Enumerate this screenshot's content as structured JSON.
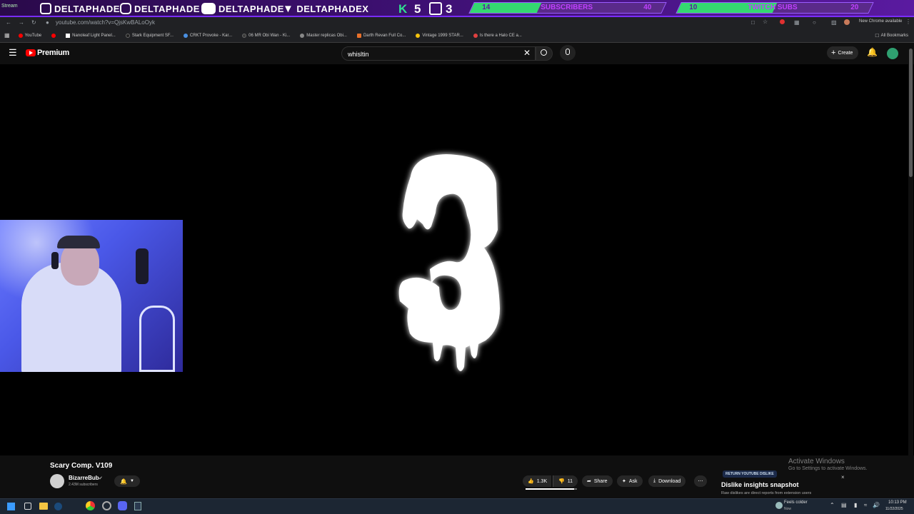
{
  "overlay": {
    "socials": [
      {
        "icon": "twitch-icon",
        "handle": "DELTAPHADE"
      },
      {
        "icon": "instagram-icon",
        "handle": "DELTAPHADE"
      },
      {
        "icon": "youtube-icon",
        "handle": "DELTAPHADE"
      },
      {
        "icon": "twitter-icon",
        "handle": "DELTAPHADEX"
      }
    ],
    "k_count": "5",
    "sub_count": "3",
    "goals": [
      {
        "current": "14",
        "label": "SUBSCRIBERS",
        "target": "40",
        "progress": 0.35
      },
      {
        "current": "10",
        "label": "TWITCH SUBS",
        "target": "20",
        "progress": 0.5
      }
    ]
  },
  "browser": {
    "tab_label": "Stream",
    "url": "youtube.com/watch?v=QjsKwBALoOyk",
    "chrome_notice": "New Chrome available",
    "all_bookmarks": "All Bookmarks",
    "bookmarks": [
      {
        "label": "YouTube",
        "color": "#ff0000"
      },
      {
        "label": "",
        "color": "#ff0000"
      },
      {
        "label": "Nanoleaf Light Panel...",
        "color": "#ffffff"
      },
      {
        "label": "Stark Equipment SF...",
        "color": "#1f1f1f"
      },
      {
        "label": "CRKT Provoke - Kar...",
        "color": "#4a90e2"
      },
      {
        "label": "06 MR Obi Wan - Ki...",
        "color": "#3a3a3a"
      },
      {
        "label": "Master replicas Obi...",
        "color": "#888888"
      },
      {
        "label": "Darth Revan Full Co...",
        "color": "#e8702a"
      },
      {
        "label": "Vintage 1999 STAR...",
        "color": "#f4c20d"
      },
      {
        "label": "Is there a Halo CE a...",
        "color": "#e04040"
      }
    ]
  },
  "youtube": {
    "brand": "Premium",
    "search_value": "whisltin",
    "create_label": "Create"
  },
  "video": {
    "countdown": "3",
    "title": "Scary Comp. V109",
    "channel": "BizarreBub",
    "subscribers": "2.43M subscribers",
    "likes": "1.3K",
    "dislikes": "11",
    "share": "Share",
    "ask": "Ask",
    "download": "Download"
  },
  "extension": {
    "badge": "RETURN YOUTUBE DISLIKE",
    "title": "Dislike insights snapshot",
    "subtitle": "Raw dislikes are direct reports from extension users"
  },
  "windows": {
    "activate_title": "Activate Windows",
    "activate_sub": "Go to Settings to activate Windows.",
    "weather_title": "Feels colder",
    "weather_sub": "Now",
    "time": "10:13 PM",
    "date": "11/22/2025"
  },
  "colors": {
    "overlay_accent": "#7a2cff",
    "goal_fill": "#34d870",
    "youtube_red": "#ff0000"
  }
}
